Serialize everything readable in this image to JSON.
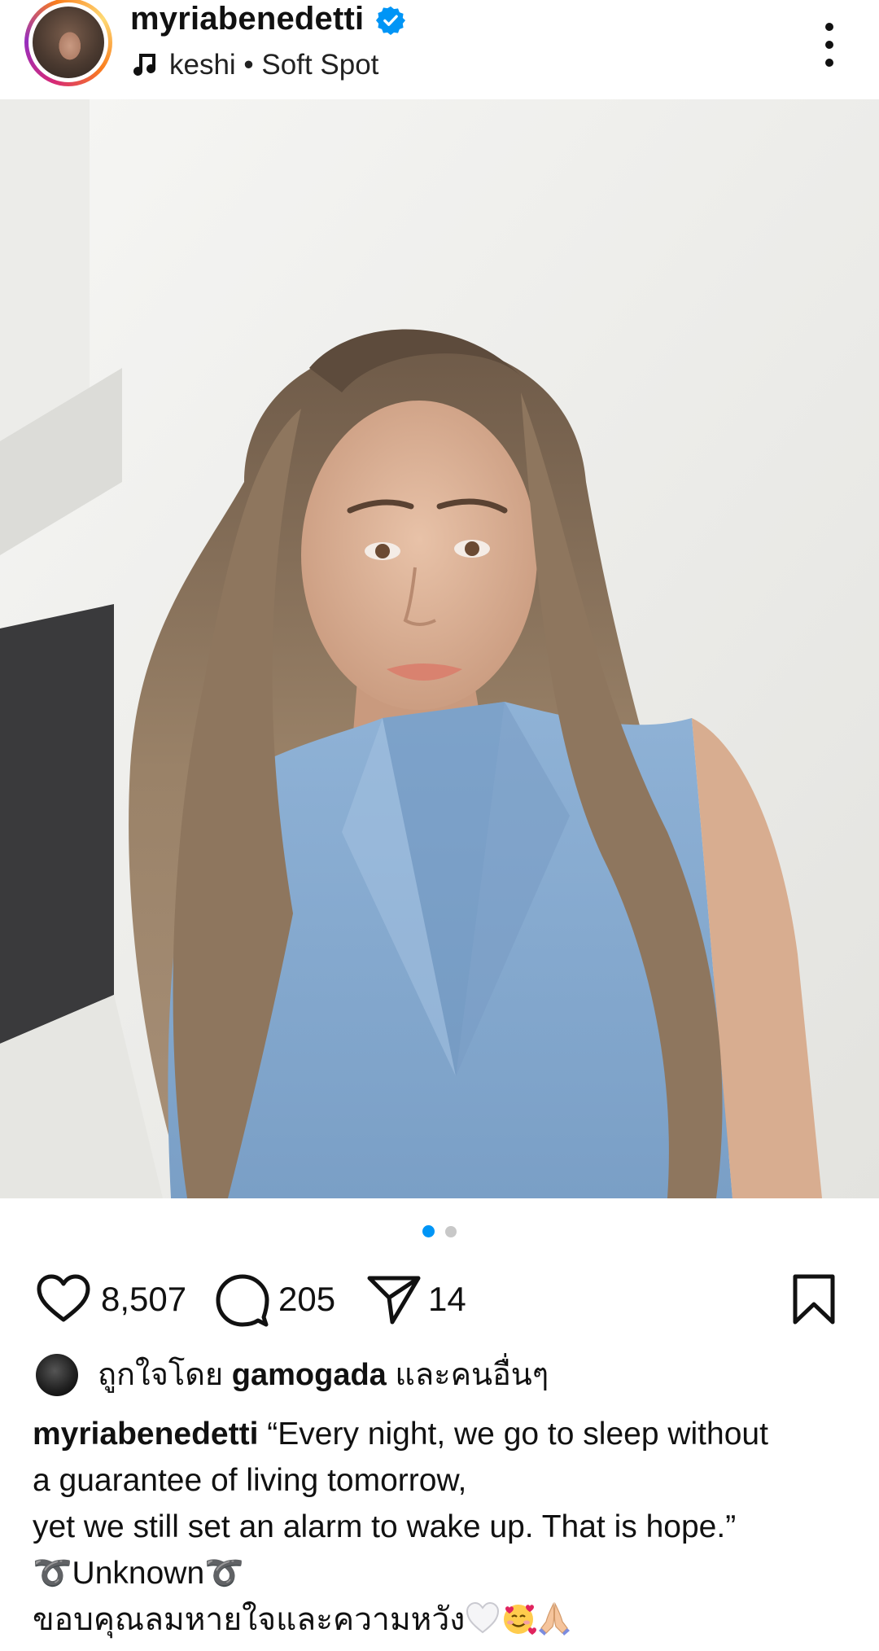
{
  "header": {
    "username": "myriabenedetti",
    "verified": true,
    "music": "keshi • Soft Spot",
    "more_icon": "more-vertical-icon"
  },
  "media": {
    "subject": "photo",
    "mute_icon": "speaker-muted-icon",
    "carousel_total": 2,
    "carousel_active": 1
  },
  "actions": {
    "likes": "8,507",
    "comments": "205",
    "shares": "14",
    "like_icon": "heart-icon",
    "comment_icon": "comment-bubble-icon",
    "share_icon": "paper-plane-icon",
    "save_icon": "bookmark-icon"
  },
  "liked_by": {
    "prefix": "ถูกใจโดย",
    "user": "gamogada",
    "suffix": "และคนอื่นๆ"
  },
  "caption": {
    "user": "myriabenedetti",
    "line1": "“Every night, we go to sleep without",
    "line2": "a guarantee of living tomorrow,",
    "line3": "yet we still set an alarm to wake up. That is hope.”",
    "line4": "➰Unknown➰",
    "line5": "ขอบคุณลมหายใจและความหวัง"
  },
  "colors": {
    "accent": "#0095f6",
    "verified": "#0095f6",
    "text": "#111111"
  }
}
